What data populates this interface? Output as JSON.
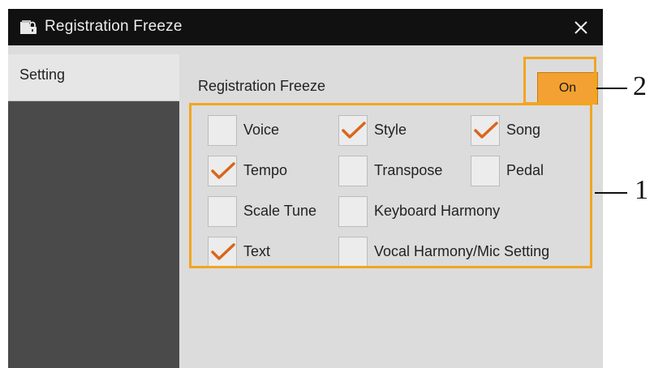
{
  "title": "Registration Freeze",
  "close_label": "×",
  "sidebar": {
    "tab": "Setting"
  },
  "section_label": "Registration Freeze",
  "on_button": "On",
  "params": {
    "voice": {
      "label": "Voice",
      "checked": false
    },
    "style": {
      "label": "Style",
      "checked": true
    },
    "song": {
      "label": "Song",
      "checked": true
    },
    "tempo": {
      "label": "Tempo",
      "checked": true
    },
    "transpose": {
      "label": "Transpose",
      "checked": false
    },
    "pedal": {
      "label": "Pedal",
      "checked": false
    },
    "scale_tune": {
      "label": "Scale Tune",
      "checked": false
    },
    "keyboard_harmony": {
      "label": "Keyboard Harmony",
      "checked": false
    },
    "text": {
      "label": "Text",
      "checked": true
    },
    "vocal_harmony": {
      "label": "Vocal Harmony/Mic Setting",
      "checked": false
    }
  },
  "callouts": {
    "one": "1",
    "two": "2"
  },
  "colors": {
    "accent": "#f2a51f",
    "check": "#d9661b",
    "on_button": "#f3a132"
  },
  "icons": {
    "title": "registration-lock-icon",
    "close": "close-icon",
    "check": "checkmark-icon"
  }
}
